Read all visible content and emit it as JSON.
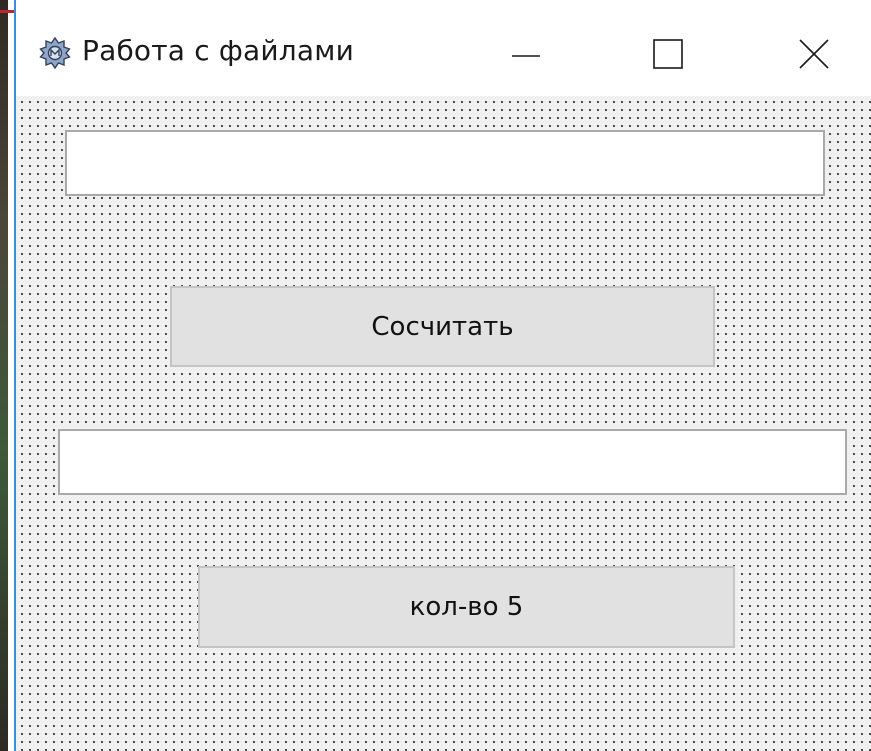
{
  "window": {
    "title": "Работа с файлами",
    "icon": "gear-app-icon",
    "controls": {
      "minimize": "minimize-icon",
      "maximize": "maximize-icon",
      "close": "close-icon"
    }
  },
  "form": {
    "input_top": {
      "value": "",
      "placeholder": ""
    },
    "count_button_label": "Сосчитать",
    "input_bottom": {
      "value": "",
      "placeholder": ""
    },
    "count_result_label": "кол-во 5"
  },
  "colors": {
    "form_background": "#f0f0f0",
    "grid_dot": "#2a2a2a",
    "button_face": "#e1e1e1",
    "textbox_border": "#a9a9a9",
    "window_accent": "#3b8fd6"
  }
}
